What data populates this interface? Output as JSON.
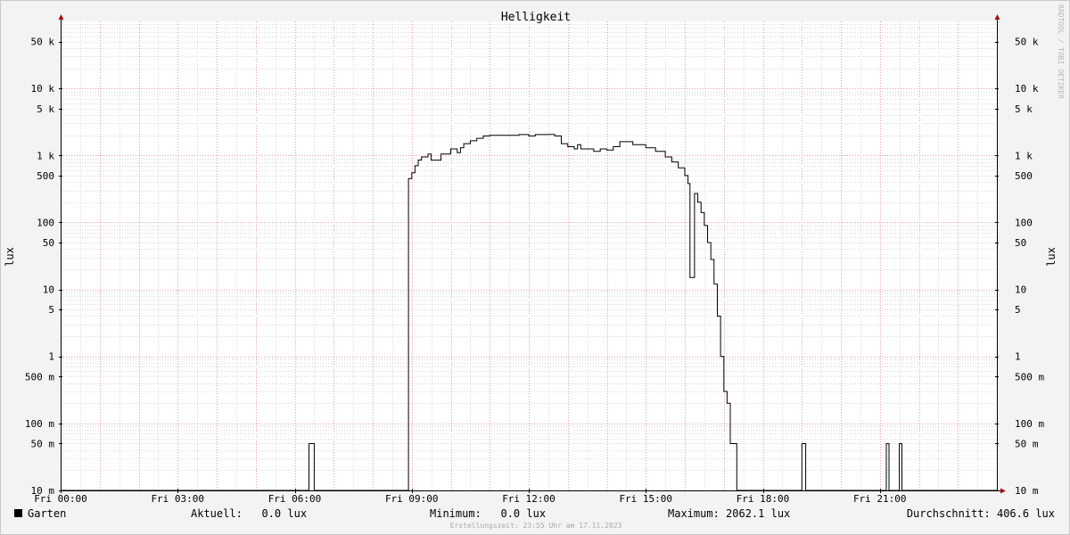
{
  "chart_data": {
    "type": "line",
    "title": "Helligkeit",
    "ylabel": "lux",
    "yscale": "log",
    "ylim": [
      0.01,
      100000
    ],
    "xlim": [
      "00:00",
      "24:00"
    ],
    "grid": true,
    "y_ticks": [
      {
        "value": 0.01,
        "label": "10 m"
      },
      {
        "value": 0.05,
        "label": "50 m"
      },
      {
        "value": 0.1,
        "label": "100 m"
      },
      {
        "value": 0.5,
        "label": "500 m"
      },
      {
        "value": 1,
        "label": "1"
      },
      {
        "value": 5,
        "label": "5"
      },
      {
        "value": 10,
        "label": "10"
      },
      {
        "value": 50,
        "label": "50"
      },
      {
        "value": 100,
        "label": "100"
      },
      {
        "value": 500,
        "label": "500"
      },
      {
        "value": 1000,
        "label": "1 k"
      },
      {
        "value": 5000,
        "label": "5 k"
      },
      {
        "value": 10000,
        "label": "10 k"
      },
      {
        "value": 50000,
        "label": "50 k"
      }
    ],
    "x_ticks": [
      {
        "time": "00:00",
        "label": "Fri 00:00"
      },
      {
        "time": "03:00",
        "label": "Fri 03:00"
      },
      {
        "time": "06:00",
        "label": "Fri 06:00"
      },
      {
        "time": "09:00",
        "label": "Fri 09:00"
      },
      {
        "time": "12:00",
        "label": "Fri 12:00"
      },
      {
        "time": "15:00",
        "label": "Fri 15:00"
      },
      {
        "time": "18:00",
        "label": "Fri 18:00"
      },
      {
        "time": "21:00",
        "label": "Fri 21:00"
      }
    ],
    "series": [
      {
        "name": "Garten",
        "color": "#000000",
        "points": [
          [
            "00:00",
            0
          ],
          [
            "06:22",
            0
          ],
          [
            "06:22",
            0.05
          ],
          [
            "06:30",
            0.05
          ],
          [
            "06:30",
            0
          ],
          [
            "08:55",
            0
          ],
          [
            "08:55",
            450
          ],
          [
            "09:00",
            550
          ],
          [
            "09:05",
            700
          ],
          [
            "09:10",
            850
          ],
          [
            "09:15",
            950
          ],
          [
            "09:25",
            1050
          ],
          [
            "09:30",
            850
          ],
          [
            "09:40",
            850
          ],
          [
            "09:45",
            1050
          ],
          [
            "10:00",
            1250
          ],
          [
            "10:10",
            1100
          ],
          [
            "10:15",
            1300
          ],
          [
            "10:20",
            1500
          ],
          [
            "10:30",
            1650
          ],
          [
            "10:40",
            1800
          ],
          [
            "10:50",
            1950
          ],
          [
            "11:00",
            2000
          ],
          [
            "11:30",
            2000
          ],
          [
            "11:45",
            2050
          ],
          [
            "12:00",
            1950
          ],
          [
            "12:10",
            2050
          ],
          [
            "12:30",
            2062
          ],
          [
            "12:40",
            1950
          ],
          [
            "12:50",
            1500
          ],
          [
            "13:00",
            1350
          ],
          [
            "13:10",
            1250
          ],
          [
            "13:15",
            1450
          ],
          [
            "13:20",
            1250
          ],
          [
            "13:40",
            1150
          ],
          [
            "13:50",
            1250
          ],
          [
            "14:00",
            1200
          ],
          [
            "14:10",
            1350
          ],
          [
            "14:20",
            1600
          ],
          [
            "14:40",
            1450
          ],
          [
            "15:00",
            1300
          ],
          [
            "15:15",
            1150
          ],
          [
            "15:30",
            950
          ],
          [
            "15:40",
            800
          ],
          [
            "15:50",
            650
          ],
          [
            "16:00",
            500
          ],
          [
            "16:05",
            380
          ],
          [
            "16:08",
            15
          ],
          [
            "16:12",
            15
          ],
          [
            "16:15",
            270
          ],
          [
            "16:20",
            200
          ],
          [
            "16:25",
            140
          ],
          [
            "16:30",
            90
          ],
          [
            "16:35",
            50
          ],
          [
            "16:40",
            28
          ],
          [
            "16:45",
            12
          ],
          [
            "16:50",
            4
          ],
          [
            "16:55",
            1
          ],
          [
            "17:00",
            0.3
          ],
          [
            "17:05",
            0.2
          ],
          [
            "17:10",
            0.05
          ],
          [
            "17:20",
            0.05
          ],
          [
            "17:20",
            0
          ],
          [
            "19:00",
            0
          ],
          [
            "19:00",
            0.05
          ],
          [
            "19:06",
            0.05
          ],
          [
            "19:06",
            0
          ],
          [
            "21:10",
            0
          ],
          [
            "21:10",
            0.05
          ],
          [
            "21:14",
            0.05
          ],
          [
            "21:14",
            0
          ],
          [
            "21:30",
            0
          ],
          [
            "21:30",
            0.05
          ],
          [
            "21:34",
            0.05
          ],
          [
            "21:34",
            0
          ],
          [
            "24:00",
            0
          ]
        ]
      }
    ]
  },
  "legend": {
    "series_name": "Garten",
    "current": "Aktuell:   0.0 lux",
    "minimum": "Minimum:   0.0 lux",
    "maximum": "Maximum: 2062.1 lux",
    "average": "Durchschnitt: 406.6 lux"
  },
  "watermark": "RRDTOOL / TOBI OETIKER",
  "footer": "Erstellungszeit: 23:55 Uhr am 17.11.2023",
  "colors": {
    "background": "#f3f3f3",
    "canvas": "#ffffff",
    "major_grid": "#e8a0a0",
    "minor_grid": "#d8d8d8",
    "axis": "#000000",
    "arrow": "#a01010",
    "line": "#000000"
  }
}
